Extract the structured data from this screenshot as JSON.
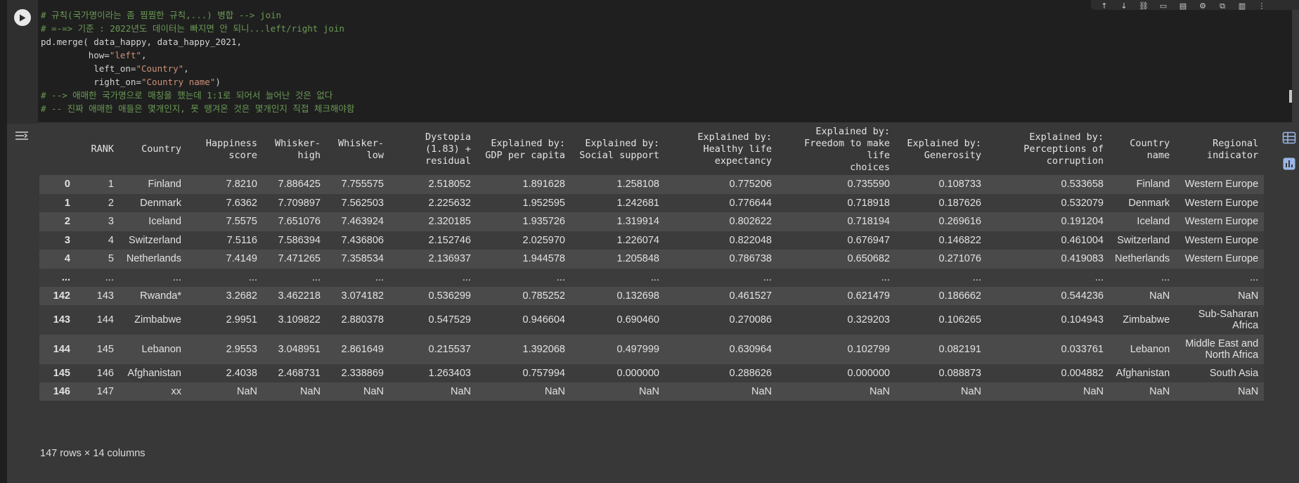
{
  "code_lines": [
    {
      "parts": [
        {
          "cls": "cm",
          "text": "# 규칙(국가명이라는 좀 찜찜한 규칙,...) 병합 --> join"
        }
      ]
    },
    {
      "parts": [
        {
          "cls": "cm",
          "text": "# =-=> 기준 : 2022년도 데이터는 빠지면 안 되니...left/right join"
        }
      ]
    },
    {
      "parts": [
        {
          "cls": "",
          "text": "pd.merge( data_happy, data_happy_2021,"
        }
      ]
    },
    {
      "parts": [
        {
          "cls": "",
          "text": "         how="
        },
        {
          "cls": "st",
          "text": "\"left\""
        },
        {
          "cls": "",
          "text": ","
        }
      ]
    },
    {
      "parts": [
        {
          "cls": "",
          "text": "          left_on="
        },
        {
          "cls": "st",
          "text": "\"Country\""
        },
        {
          "cls": "",
          "text": ","
        }
      ]
    },
    {
      "parts": [
        {
          "cls": "",
          "text": "          right_on="
        },
        {
          "cls": "st",
          "text": "\"Country name\""
        },
        {
          "cls": "",
          "text": ")"
        }
      ]
    },
    {
      "parts": [
        {
          "cls": "cm",
          "text": "# --> 애매한 국가명으로 매칭을 했는데 1:1로 되어서 늘어난 것은 없다"
        }
      ]
    },
    {
      "parts": [
        {
          "cls": "cm",
          "text": "# -- 진짜 애매한 애들은 몇개인지, 못 땡겨온 것은 몇개인지 직접 체크해야함"
        }
      ]
    }
  ],
  "columns": [
    "",
    "RANK",
    "Country",
    "Happiness\nscore",
    "Whisker-\nhigh",
    "Whisker-\nlow",
    "Dystopia\n(1.83) +\nresidual",
    "Explained by:\nGDP per capita",
    "Explained by:\nSocial support",
    "Explained by:\nHealthy life\nexpectancy",
    "Explained by:\nFreedom to make life\nchoices",
    "Explained by:\nGenerosity",
    "Explained by:\nPerceptions of\ncorruption",
    "Country\nname",
    "Regional\nindicator"
  ],
  "rows": [
    [
      "0",
      "1",
      "Finland",
      "7.8210",
      "7.886425",
      "7.755575",
      "2.518052",
      "1.891628",
      "1.258108",
      "0.775206",
      "0.735590",
      "0.108733",
      "0.533658",
      "Finland",
      "Western Europe"
    ],
    [
      "1",
      "2",
      "Denmark",
      "7.6362",
      "7.709897",
      "7.562503",
      "2.225632",
      "1.952595",
      "1.242681",
      "0.776644",
      "0.718918",
      "0.187626",
      "0.532079",
      "Denmark",
      "Western Europe"
    ],
    [
      "2",
      "3",
      "Iceland",
      "7.5575",
      "7.651076",
      "7.463924",
      "2.320185",
      "1.935726",
      "1.319914",
      "0.802622",
      "0.718194",
      "0.269616",
      "0.191204",
      "Iceland",
      "Western Europe"
    ],
    [
      "3",
      "4",
      "Switzerland",
      "7.5116",
      "7.586394",
      "7.436806",
      "2.152746",
      "2.025970",
      "1.226074",
      "0.822048",
      "0.676947",
      "0.146822",
      "0.461004",
      "Switzerland",
      "Western Europe"
    ],
    [
      "4",
      "5",
      "Netherlands",
      "7.4149",
      "7.471265",
      "7.358534",
      "2.136937",
      "1.944578",
      "1.205848",
      "0.786738",
      "0.650682",
      "0.271076",
      "0.419083",
      "Netherlands",
      "Western Europe"
    ],
    [
      "...",
      "...",
      "...",
      "...",
      "...",
      "...",
      "...",
      "...",
      "...",
      "...",
      "...",
      "...",
      "...",
      "...",
      "..."
    ],
    [
      "142",
      "143",
      "Rwanda*",
      "3.2682",
      "3.462218",
      "3.074182",
      "0.536299",
      "0.785252",
      "0.132698",
      "0.461527",
      "0.621479",
      "0.186662",
      "0.544236",
      "NaN",
      "NaN"
    ],
    [
      "143",
      "144",
      "Zimbabwe",
      "2.9951",
      "3.109822",
      "2.880378",
      "0.547529",
      "0.946604",
      "0.690460",
      "0.270086",
      "0.329203",
      "0.106265",
      "0.104943",
      "Zimbabwe",
      "Sub-Saharan\nAfrica"
    ],
    [
      "144",
      "145",
      "Lebanon",
      "2.9553",
      "3.048951",
      "2.861649",
      "0.215537",
      "1.392068",
      "0.497999",
      "0.630964",
      "0.102799",
      "0.082191",
      "0.033761",
      "Lebanon",
      "Middle East and\nNorth Africa"
    ],
    [
      "145",
      "146",
      "Afghanistan",
      "2.4038",
      "2.468731",
      "2.338869",
      "1.263403",
      "0.757994",
      "0.000000",
      "0.288626",
      "0.000000",
      "0.088873",
      "0.004882",
      "Afghanistan",
      "South Asia"
    ],
    [
      "146",
      "147",
      "xx",
      "NaN",
      "NaN",
      "NaN",
      "NaN",
      "NaN",
      "NaN",
      "NaN",
      "NaN",
      "NaN",
      "NaN",
      "NaN",
      "NaN"
    ]
  ],
  "footer": "147 rows × 14 columns"
}
